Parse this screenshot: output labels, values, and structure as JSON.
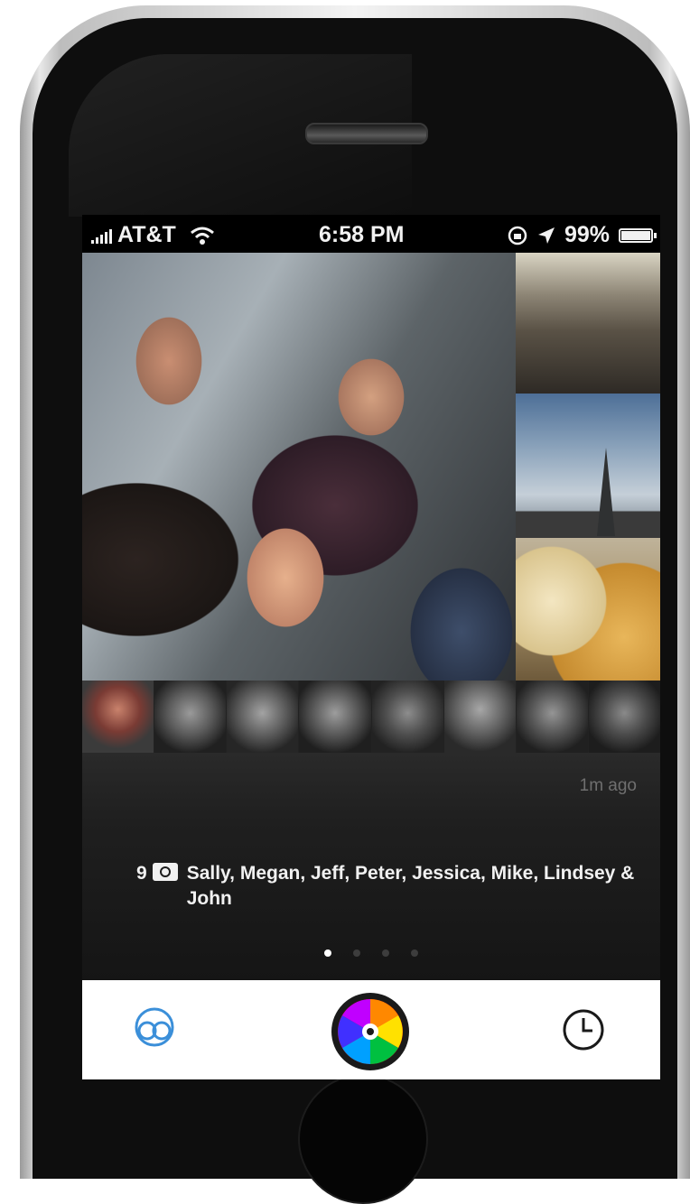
{
  "status_bar": {
    "carrier": "AT&T",
    "time": "6:58 PM",
    "battery": "99%"
  },
  "moment": {
    "timestamp": "1m ago",
    "photo_count": "9",
    "people": "Sally, Megan, Jeff, Peter, Jessica, Mike, Lindsey & John"
  },
  "pager": {
    "total_pages": 4,
    "active_page": 1
  },
  "tabbar": {
    "left_icon": "friends-icon",
    "center_icon": "color-wheel-camera-icon",
    "right_icon": "clock-icon"
  },
  "colors": {
    "accent_blue": "#3b8fd9"
  }
}
